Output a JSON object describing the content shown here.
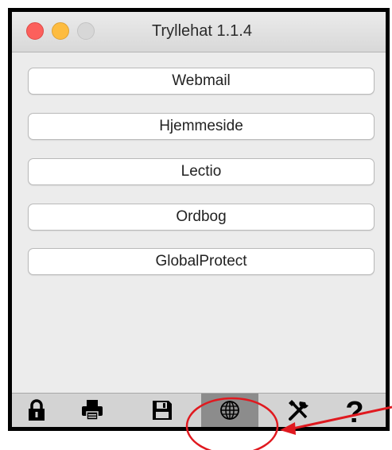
{
  "window": {
    "title": "Tryllehat 1.1.4"
  },
  "buttons": [
    "Webmail",
    "Hjemmeside",
    "Lectio",
    "Ordbog",
    "GlobalProtect"
  ],
  "toolbar": {
    "items": [
      {
        "icon": "lock-icon"
      },
      {
        "icon": "printer-icon"
      },
      {
        "icon": "save-icon"
      },
      {
        "icon": "globe-icon",
        "selected": true
      },
      {
        "icon": "tools-icon"
      },
      {
        "icon": "help-icon",
        "glyph": "?"
      }
    ]
  },
  "annotation": {
    "color": "#e0191f"
  }
}
